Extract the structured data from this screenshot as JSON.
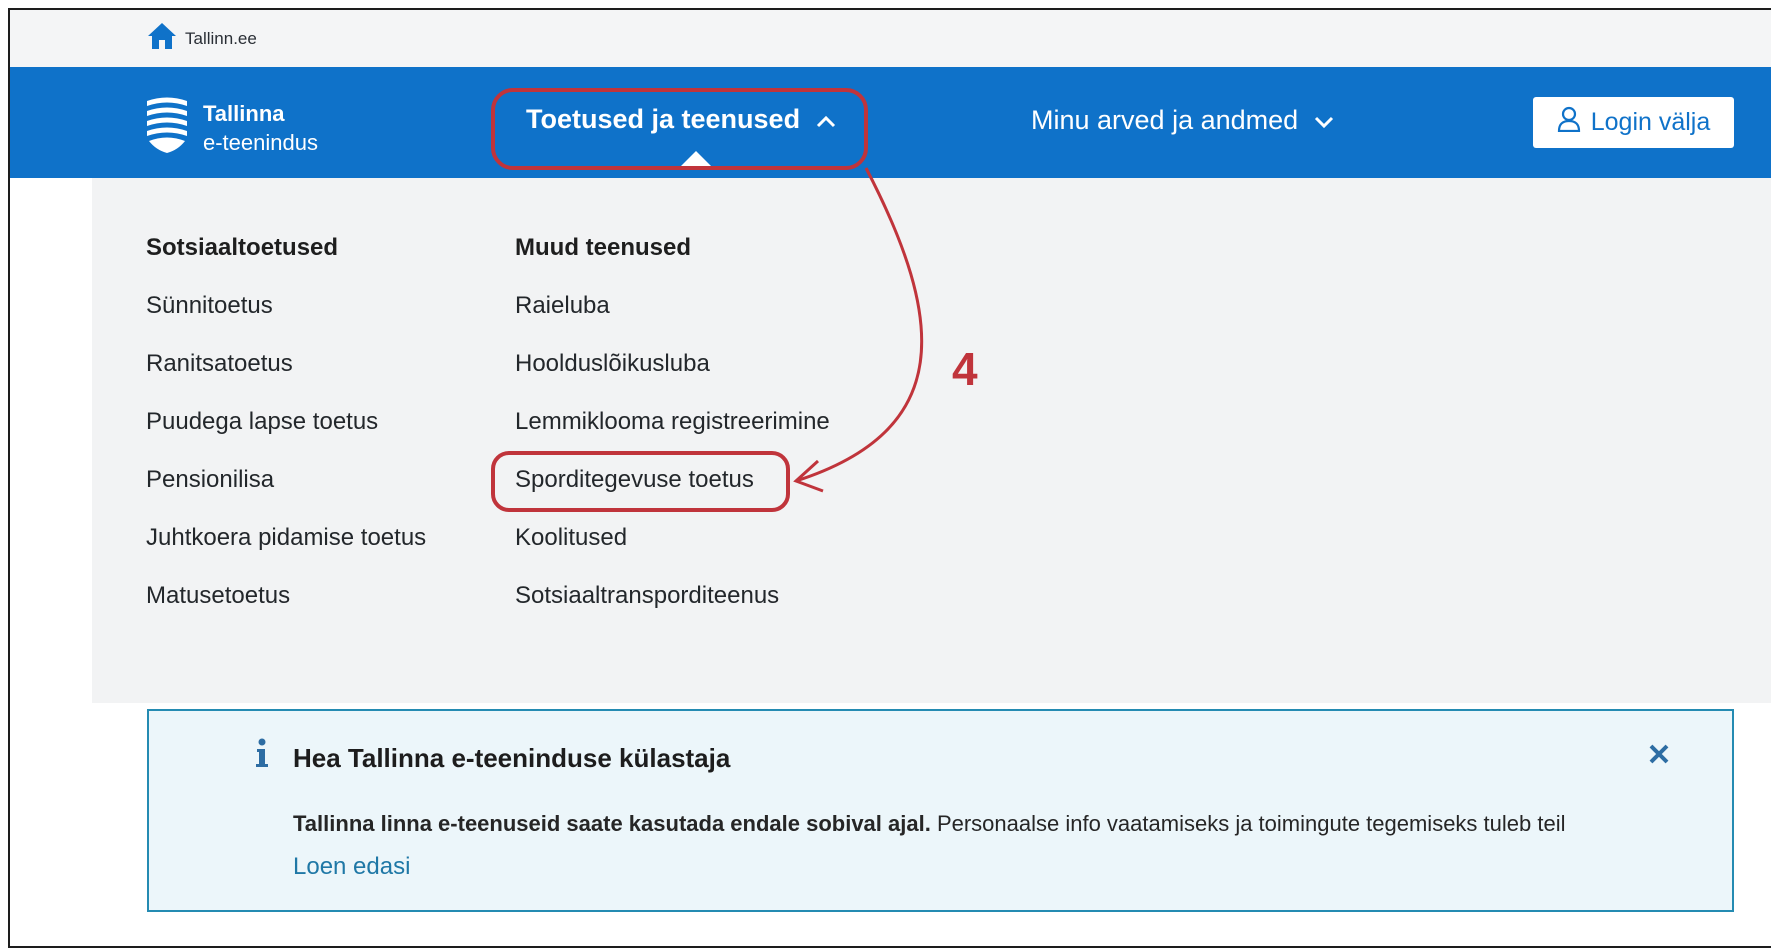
{
  "topbar": {
    "home_label": "Tallinn.ee"
  },
  "brand": {
    "line1": "Tallinna",
    "line2": "e-teenindus"
  },
  "nav": {
    "item1_label": "Toetused ja teenused",
    "item2_label": "Minu arved ja andmed",
    "login_label": "Login välja"
  },
  "dropdown": {
    "col1": {
      "heading": "Sotsiaaltoetused",
      "items": [
        "Sünnitoetus",
        "Ranitsatoetus",
        "Puudega lapse toetus",
        "Pensionilisa",
        "Juhtkoera pidamise toetus",
        "Matusetoetus"
      ]
    },
    "col2": {
      "heading": "Muud teenused",
      "items": [
        "Raieluba",
        "Hoolduslõikusluba",
        "Lemmiklooma registreerimine",
        "Sporditegevuse toetus",
        "Koolitused",
        "Sotsiaaltransporditeenus"
      ]
    }
  },
  "annotation": {
    "step_number": "4",
    "color": "#c0343b"
  },
  "notice": {
    "title": "Hea Tallinna e-teeninduse külastaja",
    "body_bold": "Tallinna linna e-teenuseid saate kasutada endale sobival ajal.",
    "body_text": " Personaalse info vaatamiseks ja toimingute tegemiseks tuleb teil",
    "read_more": "Loen edasi"
  },
  "colors": {
    "brand_blue": "#0f72c9",
    "notice_border": "#248bb2",
    "notice_bg": "#ecf6fa"
  }
}
